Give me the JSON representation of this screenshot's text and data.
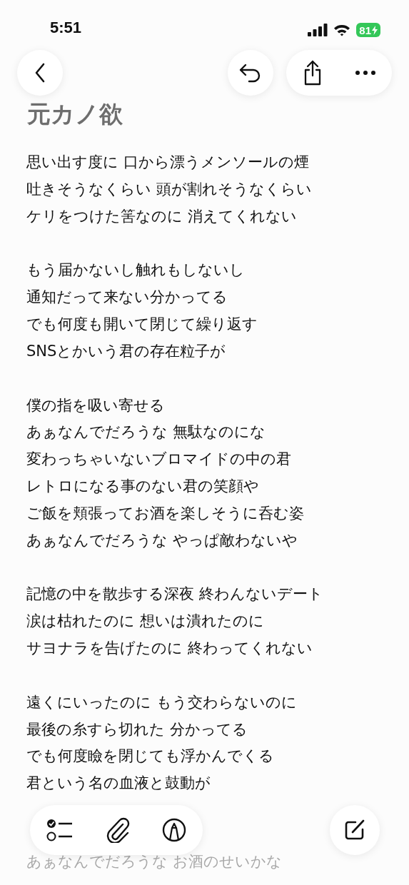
{
  "status_bar": {
    "time": "5:51",
    "battery": "81"
  },
  "note": {
    "title": "元カノ欲",
    "stanzas": [
      {
        "faded": false,
        "lines": [
          "思い出す度に 口から漂うメンソールの煙",
          "吐きそうなくらい 頭が割れそうなくらい",
          "ケリをつけた筈なのに 消えてくれない"
        ]
      },
      {
        "faded": false,
        "lines": [
          "もう届かないし触れもしないし",
          "通知だって来ない分かってる",
          "でも何度も開いて閉じて繰り返す",
          "SNSとかいう君の存在粒子が"
        ]
      },
      {
        "faded": false,
        "lines": [
          "僕の指を吸い寄せる",
          "あぁなんでだろうな 無駄なのにな",
          "変わっちゃいないブロマイドの中の君",
          "レトロになる事のない君の笑顔や",
          "ご飯を頬張ってお酒を楽しそうに呑む姿",
          "あぁなんでだろうな やっぱ敵わないや"
        ]
      },
      {
        "faded": false,
        "lines": [
          "記憶の中を散歩する深夜 終わんないデート",
          "涙は枯れたのに 想いは潰れたのに",
          "サヨナラを告げたのに 終わってくれない"
        ]
      },
      {
        "faded": false,
        "lines": [
          "遠くにいったのに もう交わらないのに",
          "最後の糸すら切れた 分かってる",
          "でも何度瞼を閉じても浮かんでくる",
          "君という名の血液と鼓動が"
        ]
      },
      {
        "faded": true,
        "lines": [
          "あぁなんでだろうな お酒のせいかな"
        ]
      }
    ]
  }
}
